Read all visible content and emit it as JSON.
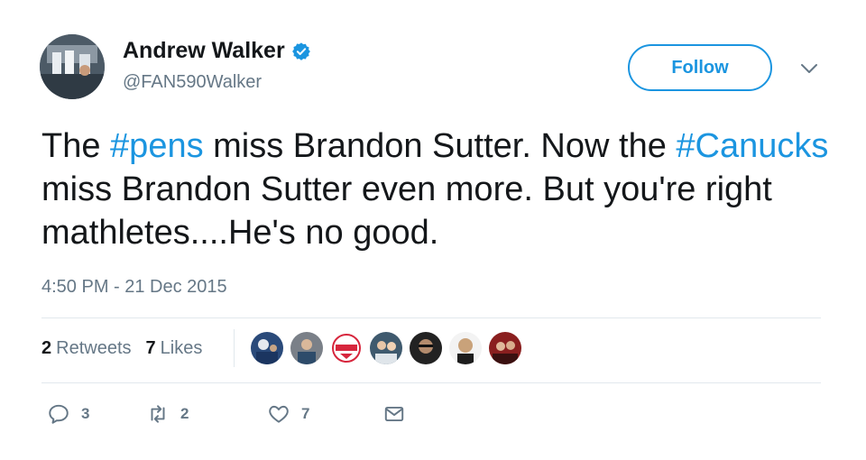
{
  "author": {
    "display_name": "Andrew Walker",
    "handle": "@FAN590Walker",
    "verified": true,
    "verified_color": "#1b95e0"
  },
  "follow_button": {
    "label": "Follow",
    "color": "#1b95e0"
  },
  "tweet": {
    "segments": [
      {
        "text": "The ",
        "type": "text"
      },
      {
        "text": "#pens",
        "type": "hashtag"
      },
      {
        "text": " miss Brandon Sutter. Now the ",
        "type": "text"
      },
      {
        "text": "#Canucks",
        "type": "hashtag"
      },
      {
        "text": " miss Brandon Sutter even more. But you're right mathletes....He's no good.",
        "type": "text"
      }
    ],
    "timestamp": "4:50 PM - 21 Dec 2015"
  },
  "stats": {
    "retweets_count": "2",
    "retweets_label": "Retweets",
    "likes_count": "7",
    "likes_label": "Likes"
  },
  "liker_avatars": [
    {
      "name": "liker-1",
      "color": "#2a4a7a"
    },
    {
      "name": "liker-2",
      "color": "#7a8088"
    },
    {
      "name": "liker-3",
      "color": "#d7263d"
    },
    {
      "name": "liker-4",
      "color": "#3f5a6e"
    },
    {
      "name": "liker-5",
      "color": "#222222"
    },
    {
      "name": "liker-6",
      "color": "#c9a27a"
    },
    {
      "name": "liker-7",
      "color": "#8a1f1f"
    }
  ],
  "actions": {
    "reply_count": "3",
    "retweet_count": "2",
    "like_count": "7",
    "icons": [
      "reply-icon",
      "retweet-icon",
      "heart-icon",
      "direct-message-icon"
    ]
  }
}
